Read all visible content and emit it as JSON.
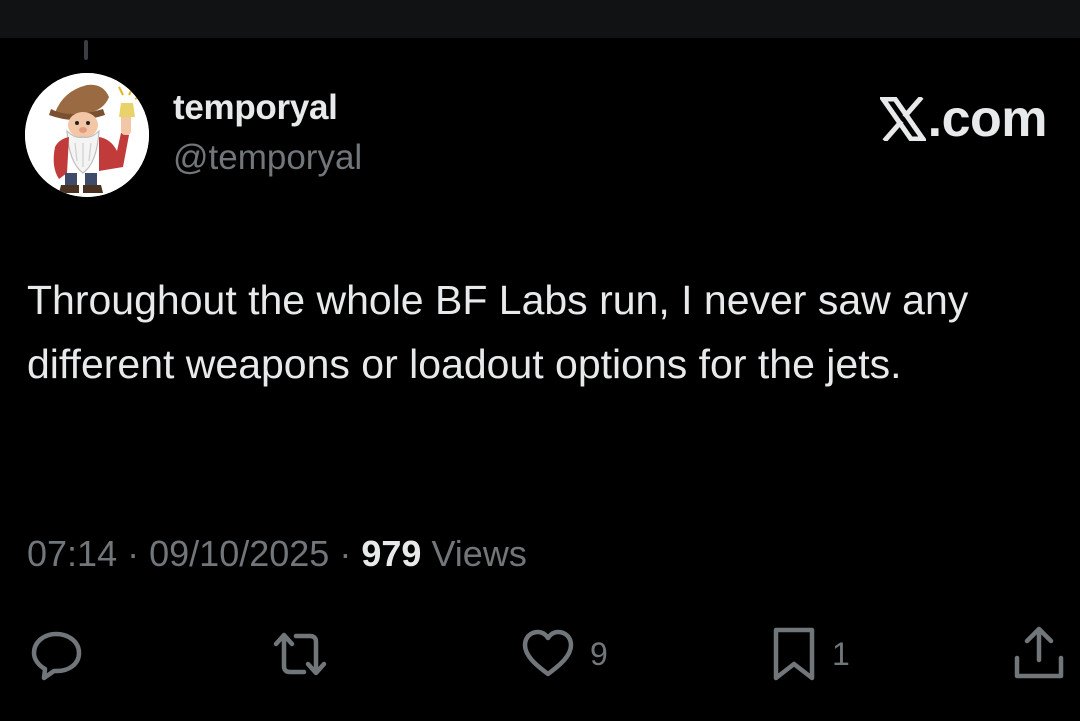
{
  "tweet": {
    "display_name": "temporyal",
    "handle": "@temporyal",
    "text": "Throughout the whole BF Labs run, I never saw any different weapons or loadout options for the jets.",
    "time": "07:14",
    "date": "09/10/2025",
    "views_count": "979",
    "views_label": "Views",
    "separator": "·"
  },
  "brand": {
    "text": ".com",
    "logo_icon": "x-logo-icon"
  },
  "actions": {
    "reply": {
      "icon": "reply-icon"
    },
    "retweet": {
      "icon": "retweet-icon"
    },
    "like": {
      "icon": "heart-icon",
      "count": "9"
    },
    "bookmark": {
      "icon": "bookmark-icon",
      "count": "1"
    },
    "share": {
      "icon": "share-icon"
    }
  },
  "colors": {
    "background": "#000000",
    "primary_text": "#e7e9ea",
    "secondary_text": "#71767b"
  }
}
